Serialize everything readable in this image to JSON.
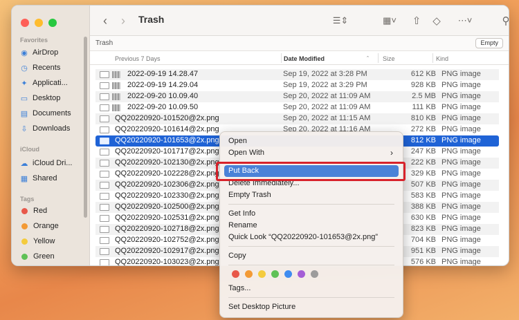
{
  "window": {
    "title": "Trash"
  },
  "sidebar": {
    "favorites_label": "Favorites",
    "favorites": [
      {
        "label": "AirDrop",
        "icon": "airdrop-icon"
      },
      {
        "label": "Recents",
        "icon": "clock-icon"
      },
      {
        "label": "Applicati...",
        "icon": "applications-icon"
      },
      {
        "label": "Desktop",
        "icon": "desktop-icon"
      },
      {
        "label": "Documents",
        "icon": "document-icon"
      },
      {
        "label": "Downloads",
        "icon": "download-icon"
      }
    ],
    "icloud_label": "iCloud",
    "icloud": [
      {
        "label": "iCloud Dri...",
        "icon": "cloud-icon"
      },
      {
        "label": "Shared",
        "icon": "shared-folder-icon"
      }
    ],
    "tags_label": "Tags",
    "tags": [
      {
        "label": "Red",
        "color": "#e8584a"
      },
      {
        "label": "Orange",
        "color": "#f39a35"
      },
      {
        "label": "Yellow",
        "color": "#f4cb3d"
      },
      {
        "label": "Green",
        "color": "#5fc156"
      }
    ]
  },
  "pathbar": {
    "label": "Trash",
    "empty_button": "Empty"
  },
  "columns": {
    "name": "Previous 7 Days",
    "date": "Date Modified",
    "size": "Size",
    "kind": "Kind"
  },
  "files": [
    {
      "name": "2022-09-19 14.28.47",
      "date": "Sep 19, 2022 at 3:28 PM",
      "size": "612 KB",
      "kind": "PNG image",
      "blurred": true
    },
    {
      "name": "2022-09-19 14.29.04",
      "date": "Sep 19, 2022 at 3:29 PM",
      "size": "928 KB",
      "kind": "PNG image",
      "blurred": true
    },
    {
      "name": "2022-09-20 10.09.40",
      "date": "Sep 20, 2022 at 11:09 AM",
      "size": "2.5 MB",
      "kind": "PNG image",
      "blurred": true
    },
    {
      "name": "2022-09-20 10.09.50",
      "date": "Sep 20, 2022 at 11:09 AM",
      "size": "111 KB",
      "kind": "PNG image",
      "blurred": true
    },
    {
      "name": "QQ20220920-101520@2x.png",
      "date": "Sep 20, 2022 at 11:15 AM",
      "size": "810 KB",
      "kind": "PNG image"
    },
    {
      "name": "QQ20220920-101614@2x.png",
      "date": "Sep 20, 2022 at 11:16 AM",
      "size": "272 KB",
      "kind": "PNG image"
    },
    {
      "name": "QQ20220920-101653@2x.png",
      "date": "",
      "size": "812 KB",
      "kind": "PNG image",
      "selected": true
    },
    {
      "name": "QQ20220920-101717@2x.png",
      "date": "",
      "size": "247 KB",
      "kind": "PNG image"
    },
    {
      "name": "QQ20220920-102130@2x.png",
      "date": "",
      "size": "222 KB",
      "kind": "PNG image"
    },
    {
      "name": "QQ20220920-102228@2x.png",
      "date": "",
      "size": "329 KB",
      "kind": "PNG image"
    },
    {
      "name": "QQ20220920-102306@2x.png",
      "date": "",
      "size": "507 KB",
      "kind": "PNG image"
    },
    {
      "name": "QQ20220920-102330@2x.png",
      "date": "",
      "size": "583 KB",
      "kind": "PNG image"
    },
    {
      "name": "QQ20220920-102500@2x.png",
      "date": "",
      "size": "388 KB",
      "kind": "PNG image"
    },
    {
      "name": "QQ20220920-102531@2x.png",
      "date": "",
      "size": "630 KB",
      "kind": "PNG image"
    },
    {
      "name": "QQ20220920-102718@2x.png",
      "date": "",
      "size": "823 KB",
      "kind": "PNG image"
    },
    {
      "name": "QQ20220920-102752@2x.png",
      "date": "",
      "size": "704 KB",
      "kind": "PNG image"
    },
    {
      "name": "QQ20220920-102917@2x.png",
      "date": "",
      "size": "951 KB",
      "kind": "PNG image"
    },
    {
      "name": "QQ20220920-103023@2x.png",
      "date": "",
      "size": "576 KB",
      "kind": "PNG image"
    }
  ],
  "context_menu": {
    "open": "Open",
    "open_with": "Open With",
    "put_back": "Put Back",
    "delete_immediately": "Delete Immediately...",
    "empty_trash": "Empty Trash",
    "get_info": "Get Info",
    "rename": "Rename",
    "quick_look": "Quick Look “QQ20220920-101653@2x.png”",
    "copy": "Copy",
    "tags": "Tags...",
    "set_desktop_picture": "Set Desktop Picture",
    "tag_colors": [
      "#e8584a",
      "#f39a35",
      "#f4cb3d",
      "#5fc156",
      "#3f8cf0",
      "#a45ed6",
      "#9c9c9c"
    ]
  }
}
